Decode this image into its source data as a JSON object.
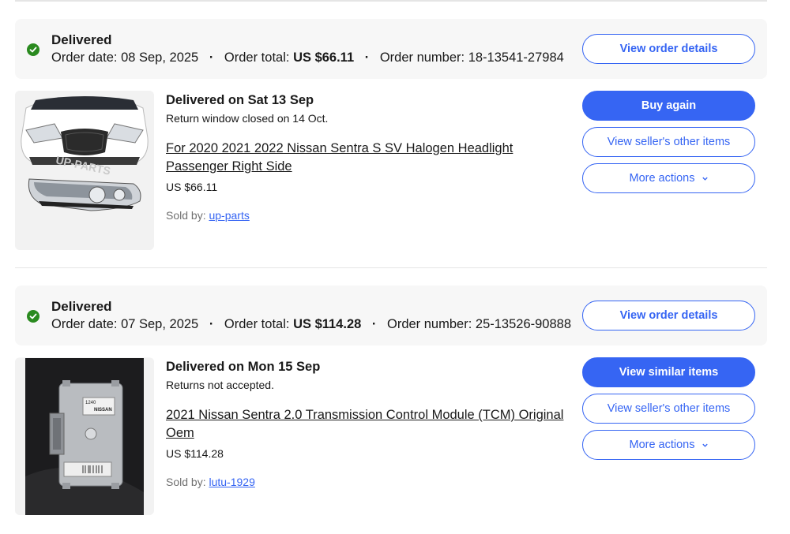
{
  "colors": {
    "accent": "#3665f3",
    "success": "#2a8a1f",
    "header_bg": "#f7f7f7"
  },
  "orders": [
    {
      "status": "Delivered",
      "order_date_label": "Order date:",
      "order_date": "08 Sep, 2025",
      "order_total_label": "Order total:",
      "order_total": "US $66.11",
      "order_number_label": "Order number:",
      "order_number": "18-13541-27984",
      "view_order_details": "View order details",
      "item": {
        "delivered_on": "Delivered on Sat 13 Sep",
        "return_note": "Return window closed on 14 Oct.",
        "title": "For 2020 2021 2022 Nissan Sentra S SV Halogen Headlight Passenger Right Side",
        "price": "US $66.11",
        "sold_by_label": "Sold by:",
        "seller": "up-parts",
        "watermark": "UP-PARTS",
        "primary_action": "Buy again",
        "seller_items": "View seller's other items",
        "more_actions": "More actions"
      }
    },
    {
      "status": "Delivered",
      "order_date_label": "Order date:",
      "order_date": "07 Sep, 2025",
      "order_total_label": "Order total:",
      "order_total": "US $114.28",
      "order_number_label": "Order number:",
      "order_number": "25-13526-90888",
      "view_order_details": "View order details",
      "item": {
        "delivered_on": "Delivered on Mon 15 Sep",
        "return_note": "Returns not accepted.",
        "title": "2021 Nissan Sentra 2.0 Transmission Control Module (TCM) Original Oem",
        "price": "US $114.28",
        "sold_by_label": "Sold by:",
        "seller": "lutu-1929",
        "label_brand": "NISSAN",
        "label_code": "1240",
        "primary_action": "View similar items",
        "seller_items": "View seller's other items",
        "more_actions": "More actions"
      }
    }
  ]
}
